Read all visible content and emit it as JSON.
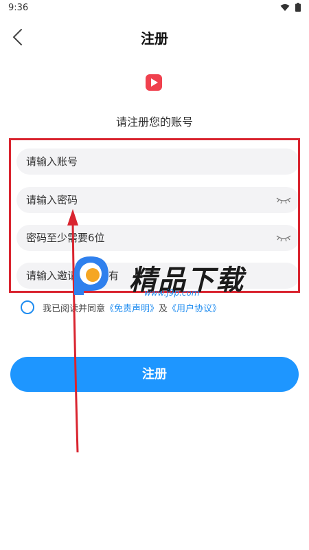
{
  "status_bar": {
    "time": "9:36"
  },
  "header": {
    "title": "注册"
  },
  "subtitle": "请注册您的账号",
  "fields": {
    "account_placeholder": "请输入账号",
    "password_placeholder": "请输入密码",
    "password_confirm_placeholder": "密码至少需要6位",
    "invite_placeholder": "请输入邀请码，没有"
  },
  "agreement": {
    "prefix": "我已阅读并同意",
    "disclaimer_link": "《免责声明》",
    "connector": "及",
    "user_agreement_link": "《用户协议》"
  },
  "register_button_label": "注册",
  "watermark": {
    "title": "精品下载",
    "url": "www.j9p.com"
  },
  "colors": {
    "accent": "#1e96ff",
    "link": "#1e8cf0",
    "app_icon": "#f0414e",
    "annotation": "#d9242f"
  }
}
